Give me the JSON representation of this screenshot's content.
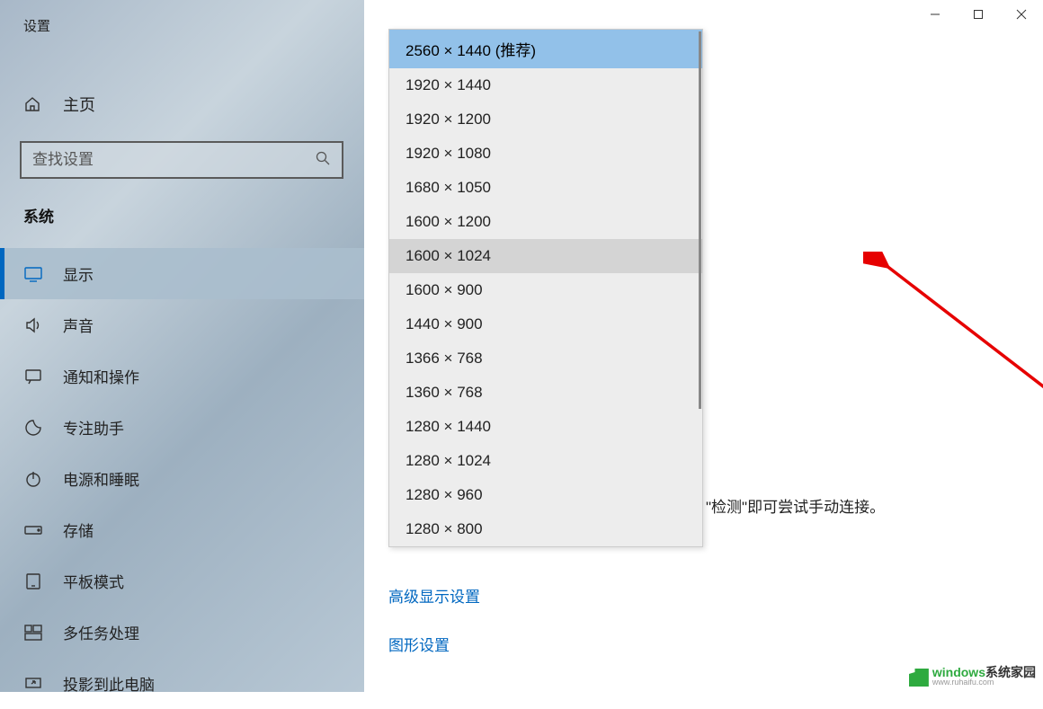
{
  "window_title": "设置",
  "home_label": "主页",
  "search": {
    "placeholder": "查找设置"
  },
  "section_label": "系统",
  "nav": [
    {
      "icon": "display-icon",
      "label": "显示",
      "active": true
    },
    {
      "icon": "sound-icon",
      "label": "声音",
      "active": false
    },
    {
      "icon": "notifications-icon",
      "label": "通知和操作",
      "active": false
    },
    {
      "icon": "focus-icon",
      "label": "专注助手",
      "active": false
    },
    {
      "icon": "power-icon",
      "label": "电源和睡眠",
      "active": false
    },
    {
      "icon": "storage-icon",
      "label": "存储",
      "active": false
    },
    {
      "icon": "tablet-icon",
      "label": "平板模式",
      "active": false
    },
    {
      "icon": "multitask-icon",
      "label": "多任务处理",
      "active": false
    },
    {
      "icon": "project-icon",
      "label": "投影到此电脑",
      "active": false
    }
  ],
  "dropdown": {
    "recommended_suffix": " (推荐)",
    "options": [
      "2560 × 1440",
      "1920 × 1440",
      "1920 × 1200",
      "1920 × 1080",
      "1680 × 1050",
      "1600 × 1200",
      "1600 × 1024",
      "1600 × 900",
      "1440 × 900",
      "1366 × 768",
      "1360 × 768",
      "1280 × 1440",
      "1280 × 1024",
      "1280 × 960",
      "1280 × 800"
    ],
    "recommended_index": 0,
    "hover_index": 6
  },
  "hint_partial": "\"检测\"即可尝试手动连接。",
  "links": {
    "advanced": "高级显示设置",
    "graphics": "图形设置"
  },
  "watermark": {
    "brand": "windows",
    "suffix": "系统家园",
    "sub": "www.ruhaifu.com"
  }
}
